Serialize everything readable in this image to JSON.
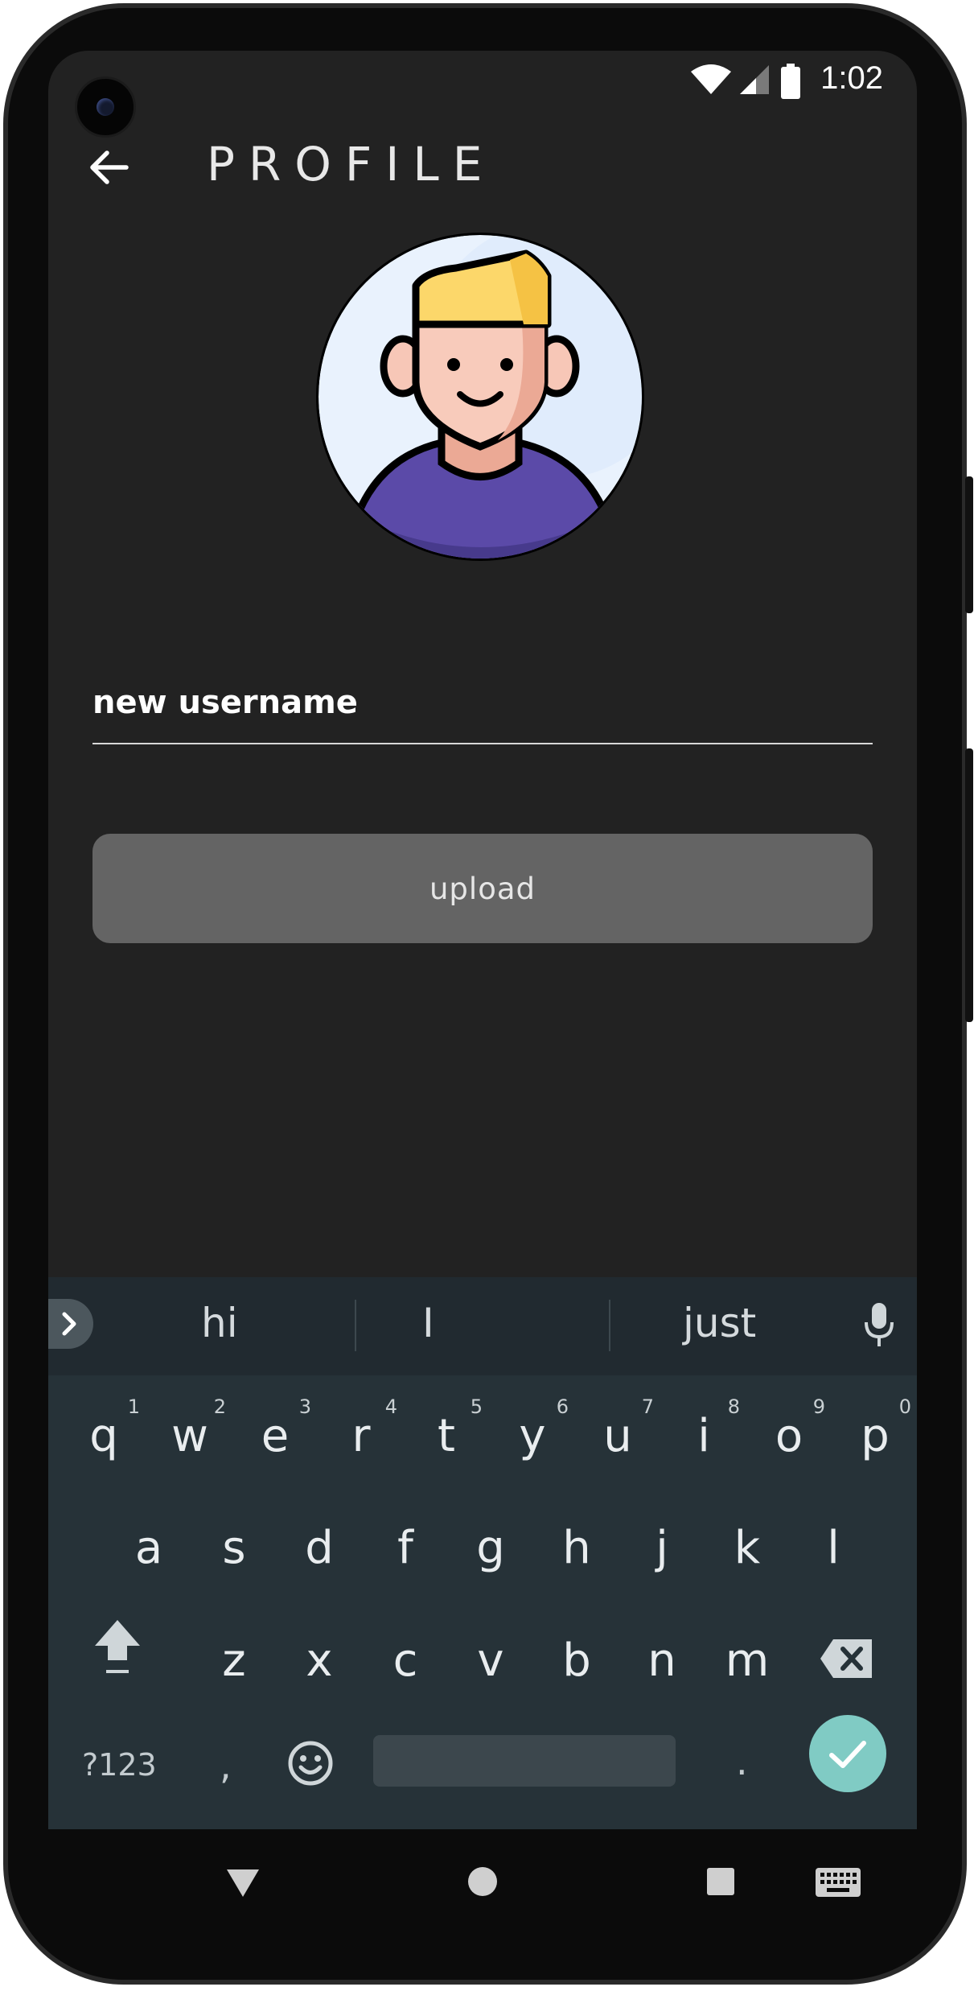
{
  "status_bar": {
    "time": "1:02",
    "icons": [
      "wifi-icon",
      "signal-icon",
      "battery-icon"
    ]
  },
  "app_bar": {
    "title": "PROFILE",
    "back_icon": "arrow-left-icon"
  },
  "form": {
    "username_value": "new username",
    "upload_label": "upload"
  },
  "keyboard": {
    "suggestions": [
      "hi",
      "I",
      "just"
    ],
    "row1": [
      {
        "key": "q",
        "hint": "1"
      },
      {
        "key": "w",
        "hint": "2"
      },
      {
        "key": "e",
        "hint": "3"
      },
      {
        "key": "r",
        "hint": "4"
      },
      {
        "key": "t",
        "hint": "5"
      },
      {
        "key": "y",
        "hint": "6"
      },
      {
        "key": "u",
        "hint": "7"
      },
      {
        "key": "i",
        "hint": "8"
      },
      {
        "key": "o",
        "hint": "9"
      },
      {
        "key": "p",
        "hint": "0"
      }
    ],
    "row2": [
      "a",
      "s",
      "d",
      "f",
      "g",
      "h",
      "j",
      "k",
      "l"
    ],
    "row3": [
      "z",
      "x",
      "c",
      "v",
      "b",
      "n",
      "m"
    ],
    "symbols_label": "?123",
    "comma": ",",
    "period": ".",
    "colors": {
      "background": "#263238",
      "enter": "#80cbc4"
    }
  },
  "nav_bar": {
    "icons": [
      "back-triangle-icon",
      "home-circle-icon",
      "recents-square-icon",
      "keyboard-icon"
    ]
  },
  "colors": {
    "screen_bg": "#222222",
    "button_bg": "#646464"
  }
}
